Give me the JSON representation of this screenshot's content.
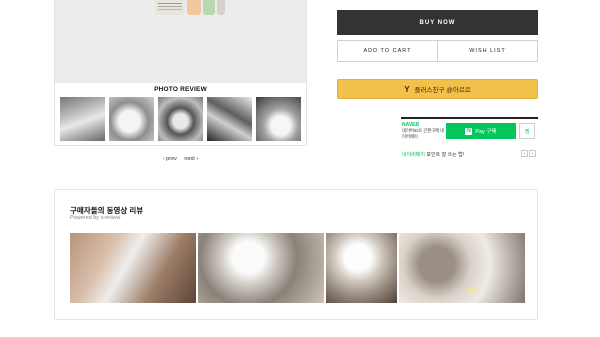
{
  "photo_review": {
    "title": "PHOTO REVIEW",
    "thumbnails": [
      "review-photo-1",
      "review-photo-2",
      "review-photo-3",
      "review-photo-4",
      "review-photo-5"
    ]
  },
  "pager": {
    "prev": "‹ prev",
    "next": "next ›"
  },
  "purchase": {
    "buy_now": "BUY NOW",
    "add_to_cart": "ADD TO CART",
    "wish_list": "WISH LIST"
  },
  "plusfriend": {
    "icon": "Y",
    "label": "플러스친구 @아르르"
  },
  "npay": {
    "logo": "NAVER",
    "sub": "네이버ID로 간편구매 네이버페이",
    "button_icon": "N",
    "button_label": "Pay 구매",
    "wish_label": "찜",
    "promo_highlight": "네이버페이",
    "promo_rest": " 포인트 잘 쓰는 법!",
    "arrow_prev": "‹",
    "arrow_next": "›"
  },
  "video_review": {
    "title": "구매자들의 동영상 리뷰",
    "subtitle": "Powered by v.review",
    "caption": "[냠냠]"
  },
  "colors": {
    "buy_now_bg": "#333333",
    "plusfriend_bg": "#f2c14b",
    "npay_green": "#03c75a"
  }
}
